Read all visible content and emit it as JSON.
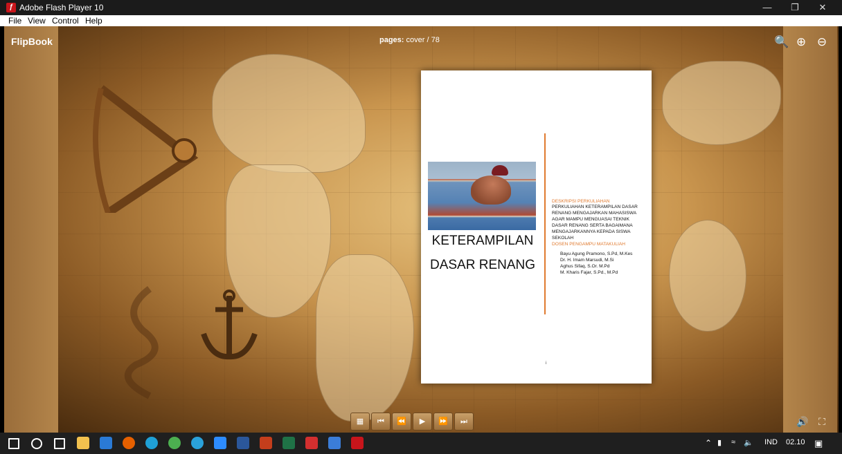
{
  "window": {
    "title": "Adobe Flash Player 10",
    "icon": "flash-player-icon",
    "minimize_icon": "minimize-icon",
    "restore_icon": "restore-icon",
    "close_icon": "close-icon"
  },
  "menu": {
    "items": [
      "File",
      "View",
      "Control",
      "Help"
    ]
  },
  "flipbook": {
    "brand": "FlipBook",
    "pages_label": "pages:",
    "pages_value": "cover / 78",
    "toolbar_icons": [
      "zoom-icon",
      "zoom-in-icon",
      "zoom-out-icon"
    ]
  },
  "cover": {
    "title_line1": "KETERAMPILAN",
    "title_line2": "DASAR RENANG",
    "photo_icon": "swimmer-photo",
    "desc_heading": "DESKRIPSI PERKULIAHAN",
    "desc_lines": [
      "PERKULIAHAN KETERAMPILAN DASAR",
      "RENANG MENGAJARKAN MAHASISWA",
      "AGAR MAMPU MENGUASAI TEKNIK",
      "DASAR RENANG SERTA BAGAIMANA",
      "MENGAJARKANNYA KEPADA SISWA",
      "SEKOLAH"
    ],
    "lecturer_heading": "DOSEN PENGAMPU MATAKULIAH",
    "lecturers": [
      "Bayu Agung Pramono, S.Pd, M.Kes",
      "Dr. H. Imam Marsudi, M.Si",
      "Aghus Sifaq, S.Or. M.Pd",
      "M. Kharis Fajar, S.Pd., M.Pd"
    ],
    "page_number": "i"
  },
  "controls": {
    "buttons": [
      "thumbnails-icon",
      "first-page-icon",
      "prev-page-icon",
      "play-icon",
      "next-page-icon",
      "last-page-icon"
    ],
    "sound_icon": "sound-icon",
    "fullscreen_icon": "fullscreen-icon"
  },
  "taskbar": {
    "apps": [
      "windows-start-icon",
      "search-icon",
      "task-view-icon",
      "file-explorer-icon",
      "mail-icon",
      "firefox-icon",
      "edge-icon",
      "chrome-icon",
      "telegram-icon",
      "zoom-icon",
      "word-icon",
      "powerpoint-icon",
      "excel-icon",
      "acrobat-icon",
      "photos-icon",
      "flash-player-icon"
    ],
    "colors": [
      "#ffffff",
      "#ffffff",
      "#ffffff",
      "#f2c14e",
      "#2a7ad6",
      "#e66000",
      "#1fa0d6",
      "#4caf50",
      "#2aa1da",
      "#2d8cff",
      "#2b579a",
      "#c43e1c",
      "#1f7246",
      "#d32f2f",
      "#3b7dd8",
      "#c8151b"
    ],
    "language": "IND",
    "time": "02.10",
    "tray_icons": [
      "chevron-up-icon",
      "battery-icon",
      "wifi-icon",
      "volume-icon",
      "notification-icon"
    ]
  }
}
